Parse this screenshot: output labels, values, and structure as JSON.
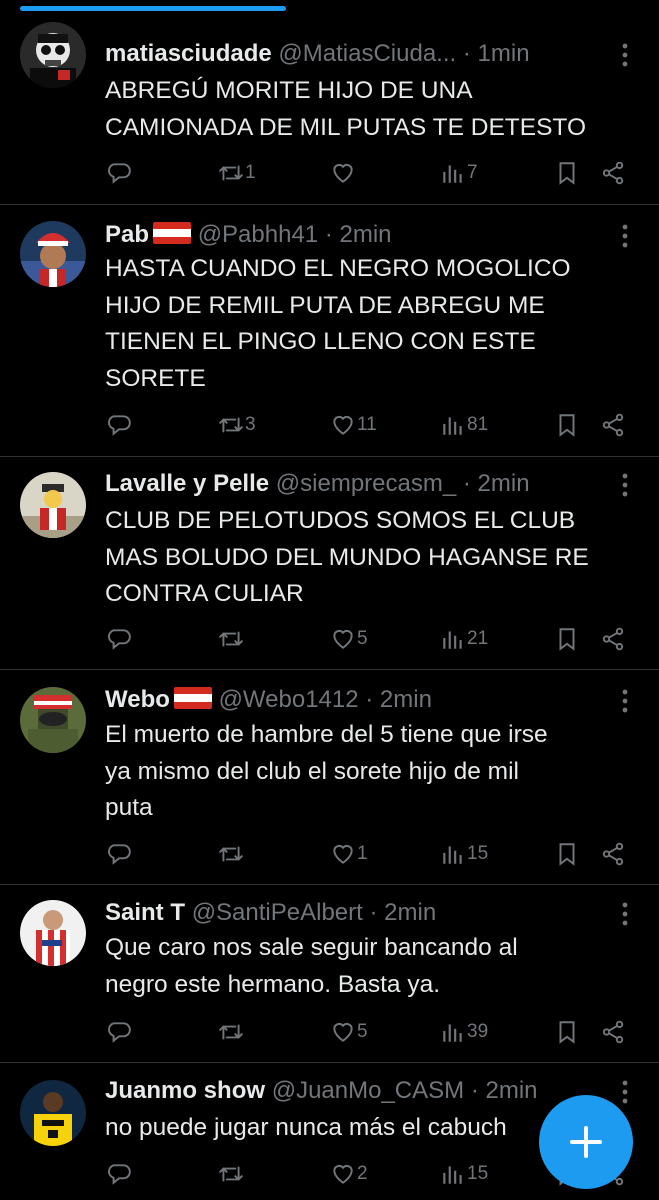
{
  "tweets": [
    {
      "name": "matiasciudade",
      "handle": "@MatiasCiuda...",
      "time": "1min",
      "has_flag": false,
      "text": [
        "ABREGÚ MORITE HIJO DE UNA",
        "CAMIONADA DE MIL PUTAS TE DETESTO"
      ],
      "replies": "",
      "retweets": "1",
      "likes": "",
      "views": "7"
    },
    {
      "name": "Pab",
      "handle": "@Pabhh41",
      "time": "2min",
      "has_flag": true,
      "text": [
        "HASTA CUANDO EL NEGRO MOGOLICO",
        "HIJO DE REMIL PUTA DE ABREGU ME",
        "TIENEN EL PINGO LLENO CON ESTE",
        "SORETE"
      ],
      "replies": "",
      "retweets": "3",
      "likes": "11",
      "views": "81"
    },
    {
      "name": "Lavalle y Pelle",
      "handle": "@siemprecasm_",
      "time": "2min",
      "has_flag": false,
      "text": [
        "CLUB DE PELOTUDOS SOMOS EL CLUB",
        "MAS BOLUDO DEL MUNDO HAGANSE RE",
        "CONTRA CULIAR"
      ],
      "replies": "",
      "retweets": "",
      "likes": "5",
      "views": "21"
    },
    {
      "name": "Webo",
      "handle": "@Webo1412",
      "time": "2min",
      "has_flag": true,
      "text": [
        "El muerto de hambre del 5 tiene que irse",
        "ya mismo del club el sorete hijo de mil",
        "puta"
      ],
      "replies": "",
      "retweets": "",
      "likes": "1",
      "views": "15"
    },
    {
      "name": "Saint T",
      "handle": "@SantiPeAlbert",
      "time": "2min",
      "has_flag": false,
      "text": [
        "Que caro nos sale seguir bancando al",
        "negro este hermano. Basta ya."
      ],
      "replies": "",
      "retweets": "",
      "likes": "5",
      "views": "39"
    },
    {
      "name": "Juanmo show",
      "handle": "@JuanMo_CASM",
      "time": "2min",
      "has_flag": false,
      "text": [
        "no puede jugar nunca más el cabuch"
      ],
      "replies": "",
      "retweets": "",
      "likes": "2",
      "views": "15"
    }
  ],
  "dot_sep": "·",
  "icons": {
    "reply": "reply-icon",
    "retweet": "retweet-icon",
    "like": "heart-icon",
    "views": "views-icon",
    "bookmark": "bookmark-icon",
    "share": "share-icon",
    "more": "more-icon",
    "compose": "compose-plus-icon"
  },
  "colors": {
    "background": "#000000",
    "text": "#e7e9ea",
    "secondary": "#71767b",
    "accent": "#1d9bf0",
    "divider": "#2f3336",
    "flag_red": "#d52b1e"
  }
}
